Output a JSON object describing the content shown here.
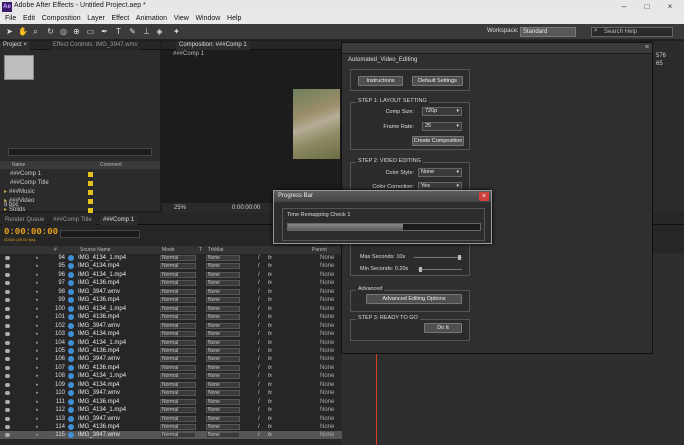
{
  "window": {
    "title": "Adobe After Effects - Untitled Project.aep *",
    "logo": "Ae"
  },
  "menu": [
    "File",
    "Edit",
    "Composition",
    "Layer",
    "Effect",
    "Animation",
    "View",
    "Window",
    "Help"
  ],
  "toolbar": {
    "workspace_label": "Workspace:",
    "workspace_value": "Standard",
    "search_placeholder": "Search Help"
  },
  "project": {
    "tabs": [
      "Project ×",
      "Effect Controls: IMG_3947.wmv"
    ],
    "columns": {
      "name": "Name",
      "comment": "Comment"
    },
    "items": [
      "###Comp 1",
      "###Comp Title",
      "###Music",
      "###Video",
      "Solids"
    ],
    "footer": "8 bpc"
  },
  "composition": {
    "tab": "Composition: ###Comp 1",
    "subtab": "###Comp 1",
    "zoom": "25%",
    "timecode": "0:00:00:00"
  },
  "right_strip": {
    "value_top": "576",
    "value_mid": "65"
  },
  "timeline": {
    "tabs": [
      "Render Queue",
      "###Comp Title",
      "###Comp 1"
    ],
    "timecode": "0:00:00:00",
    "fps": "00000 (25.00 fps)",
    "columns": {
      "hash": "#",
      "source": "Source Name",
      "mode": "Mode",
      "t": "T",
      "trkmat": "TrkMat",
      "parent": "Parent"
    },
    "rows": [
      {
        "num": "94",
        "name": "IMG_4134_1.mp4",
        "mode": "Normal",
        "trk": "None",
        "par": "None"
      },
      {
        "num": "95",
        "name": "IMG_4134.mp4",
        "mode": "Normal",
        "trk": "None",
        "par": "None"
      },
      {
        "num": "96",
        "name": "IMG_4134_1.mp4",
        "mode": "Normal",
        "trk": "None",
        "par": "None"
      },
      {
        "num": "97",
        "name": "IMG_4136.mp4",
        "mode": "Normal",
        "trk": "None",
        "par": "None"
      },
      {
        "num": "98",
        "name": "IMG_3947.wmv",
        "mode": "Normal",
        "trk": "None",
        "par": "None"
      },
      {
        "num": "99",
        "name": "IMG_4136.mp4",
        "mode": "Normal",
        "trk": "None",
        "par": "None"
      },
      {
        "num": "100",
        "name": "IMG_4134_1.mp4",
        "mode": "Normal",
        "trk": "None",
        "par": "None"
      },
      {
        "num": "101",
        "name": "IMG_4136.mp4",
        "mode": "Normal",
        "trk": "None",
        "par": "None"
      },
      {
        "num": "102",
        "name": "IMG_3947.wmv",
        "mode": "Normal",
        "trk": "None",
        "par": "None"
      },
      {
        "num": "103",
        "name": "IMG_4134.mp4",
        "mode": "Normal",
        "trk": "None",
        "par": "None"
      },
      {
        "num": "104",
        "name": "IMG_4134_1.mp4",
        "mode": "Normal",
        "trk": "None",
        "par": "None"
      },
      {
        "num": "105",
        "name": "IMG_4136.mp4",
        "mode": "Normal",
        "trk": "None",
        "par": "None"
      },
      {
        "num": "106",
        "name": "IMG_3947.wmv",
        "mode": "Normal",
        "trk": "None",
        "par": "None"
      },
      {
        "num": "107",
        "name": "IMG_4136.mp4",
        "mode": "Normal",
        "trk": "None",
        "par": "None"
      },
      {
        "num": "108",
        "name": "IMG_4134_1.mp4",
        "mode": "Normal",
        "trk": "None",
        "par": "None"
      },
      {
        "num": "109",
        "name": "IMG_4134.mp4",
        "mode": "Normal",
        "trk": "None",
        "par": "None"
      },
      {
        "num": "110",
        "name": "IMG_3947.wmv",
        "mode": "Normal",
        "trk": "None",
        "par": "None"
      },
      {
        "num": "111",
        "name": "IMG_4136.mp4",
        "mode": "Normal",
        "trk": "None",
        "par": "None"
      },
      {
        "num": "112",
        "name": "IMG_4134_1.mp4",
        "mode": "Normal",
        "trk": "None",
        "par": "None"
      },
      {
        "num": "113",
        "name": "IMG_3947.wmv",
        "mode": "Normal",
        "trk": "None",
        "par": "None"
      },
      {
        "num": "114",
        "name": "IMG_4136.mp4",
        "mode": "Normal",
        "trk": "None",
        "par": "None"
      },
      {
        "num": "115",
        "name": "IMG_3947.wmv",
        "mode": "Normal",
        "trk": "None",
        "par": "None"
      }
    ]
  },
  "automated": {
    "title": "Automated_Video_Editing",
    "instructions_btn": "Instructions",
    "defaults_btn": "Default Settings",
    "step1": "STEP 1: LAYOUT SETTING",
    "comp_size_label": "Comp Size:",
    "comp_size_value": "720p",
    "frame_rate_label": "Frame Rate:",
    "frame_rate_value": "25",
    "create_comp_btn": "Create Composition",
    "step2": "STEP 2: VIDEO EDITING",
    "color_style_label": "Color Style:",
    "color_style_value": "None",
    "color_correction_label": "Color Correction:",
    "color_correction_value": "Yes",
    "max_seconds": "Max Seconds: 10s",
    "min_seconds": "Min Seconds: 0.20s",
    "advanced": "Advanced",
    "advanced_btn": "Advanced Editing Options",
    "step3": "STEP 3: READY TO GO",
    "do_it_btn": "Do It"
  },
  "progress": {
    "title": "Progress Bar",
    "message": "Time Remapping Check 1",
    "fraction": 0.6
  }
}
